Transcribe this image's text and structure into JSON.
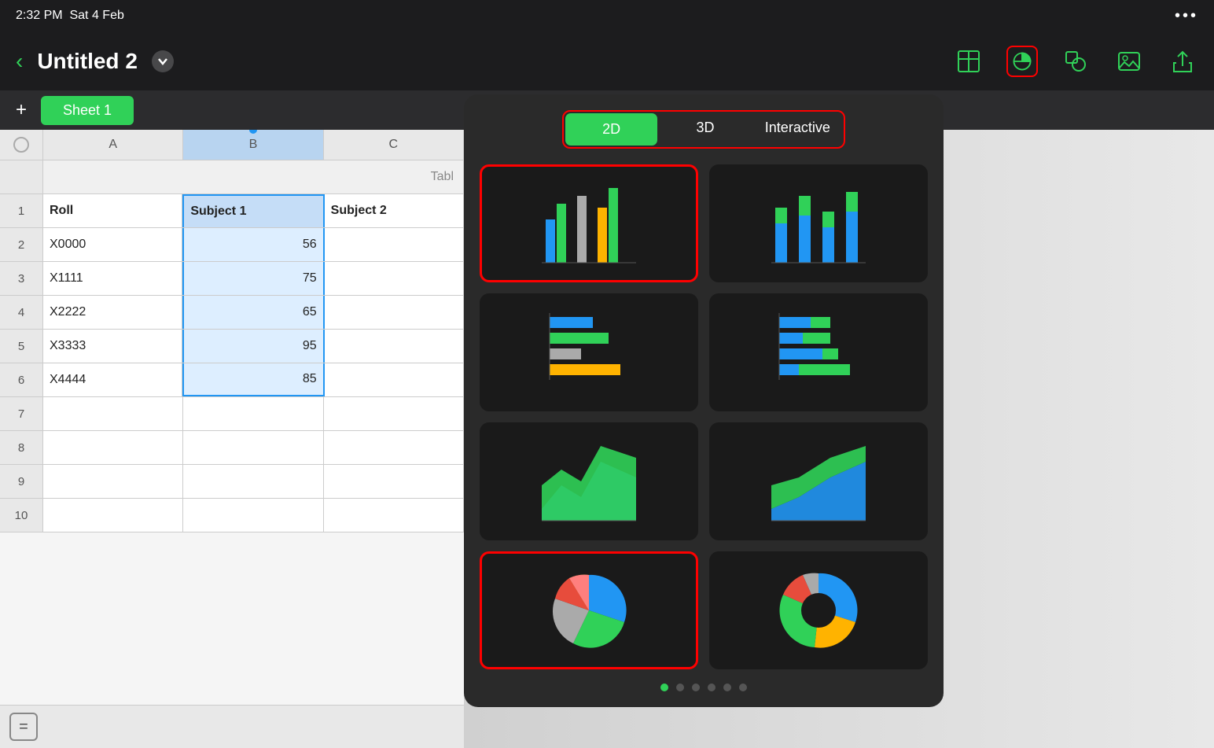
{
  "statusBar": {
    "time": "2:32 PM",
    "date": "Sat 4 Feb",
    "dots": "•••"
  },
  "toolbar": {
    "back": "‹",
    "title": "Untitled 2",
    "chevron": "∨",
    "icons": {
      "table": "table-icon",
      "chart": "chart-icon",
      "shapes": "shapes-icon",
      "media": "media-icon",
      "share": "share-icon"
    }
  },
  "sheets": {
    "addLabel": "+",
    "tabs": [
      {
        "label": "Sheet 1",
        "active": true
      }
    ]
  },
  "spreadsheet": {
    "columns": [
      "A",
      "B",
      "C"
    ],
    "tableTitle": "Tabl",
    "rows": [
      {
        "num": 1,
        "cells": [
          "Roll",
          "Subject 1",
          "Subject 2"
        ]
      },
      {
        "num": 2,
        "cells": [
          "X0000",
          "56",
          ""
        ]
      },
      {
        "num": 3,
        "cells": [
          "X1111",
          "75",
          ""
        ]
      },
      {
        "num": 4,
        "cells": [
          "X2222",
          "65",
          ""
        ]
      },
      {
        "num": 5,
        "cells": [
          "X3333",
          "95",
          ""
        ]
      },
      {
        "num": 6,
        "cells": [
          "X4444",
          "85",
          ""
        ]
      },
      {
        "num": 7,
        "cells": [
          "",
          "",
          ""
        ]
      },
      {
        "num": 8,
        "cells": [
          "",
          "",
          ""
        ]
      },
      {
        "num": 9,
        "cells": [
          "",
          "",
          ""
        ]
      },
      {
        "num": 10,
        "cells": [
          "",
          "",
          ""
        ]
      }
    ],
    "equalsBtn": "="
  },
  "chartPicker": {
    "tabs": [
      "2D",
      "3D",
      "Interactive"
    ],
    "activeTab": "2D",
    "selectedChart": "bar-grouped",
    "selectedPie": "pie",
    "paginationDots": 6,
    "activeDot": 0
  }
}
